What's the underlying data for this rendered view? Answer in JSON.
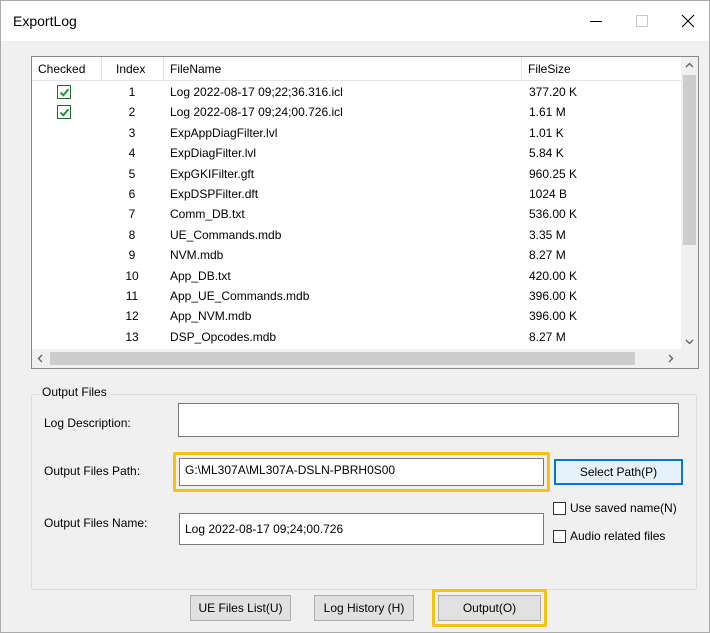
{
  "window": {
    "title": "ExportLog"
  },
  "list": {
    "columns": [
      "Checked",
      "Index",
      "FileName",
      "FileSize"
    ],
    "rows": [
      {
        "checked": true,
        "index": "1",
        "name": "Log 2022-08-17 09;22;36.316.icl",
        "size": "377.20 K"
      },
      {
        "checked": true,
        "index": "2",
        "name": "Log 2022-08-17 09;24;00.726.icl",
        "size": "1.61 M"
      },
      {
        "checked": false,
        "index": "3",
        "name": "ExpAppDiagFilter.lvl",
        "size": "1.01 K"
      },
      {
        "checked": false,
        "index": "4",
        "name": "ExpDiagFilter.lvl",
        "size": "5.84 K"
      },
      {
        "checked": false,
        "index": "5",
        "name": "ExpGKIFilter.gft",
        "size": "960.25 K"
      },
      {
        "checked": false,
        "index": "6",
        "name": "ExpDSPFilter.dft",
        "size": "1024 B"
      },
      {
        "checked": false,
        "index": "7",
        "name": "Comm_DB.txt",
        "size": "536.00 K"
      },
      {
        "checked": false,
        "index": "8",
        "name": "UE_Commands.mdb",
        "size": "3.35 M"
      },
      {
        "checked": false,
        "index": "9",
        "name": "NVM.mdb",
        "size": "8.27 M"
      },
      {
        "checked": false,
        "index": "10",
        "name": "App_DB.txt",
        "size": "420.00 K"
      },
      {
        "checked": false,
        "index": "11",
        "name": "App_UE_Commands.mdb",
        "size": "396.00 K"
      },
      {
        "checked": false,
        "index": "12",
        "name": "App_NVM.mdb",
        "size": "396.00 K"
      },
      {
        "checked": false,
        "index": "13",
        "name": "DSP_Opcodes.mdb",
        "size": "8.27 M"
      }
    ]
  },
  "output": {
    "group_title": "Output Files",
    "desc_label": "Log Description:",
    "desc_value": "",
    "path_label": "Output Files Path:",
    "path_value": "G:\\ML307A\\ML307A-DSLN-PBRH0S00",
    "select_path": "Select Path(P)",
    "name_label": "Output Files Name:",
    "name_value": "Log 2022-08-17 09;24;00.726",
    "use_saved_name": "Use saved name(N)",
    "audio_related": "Audio related files"
  },
  "buttons": {
    "ue_files": "UE Files List(U)",
    "log_history": "Log History (H)",
    "output": "Output(O)"
  },
  "colors": {
    "highlight": "#f7c312",
    "check": "#1c9b3a",
    "focus": "#0078d7"
  }
}
